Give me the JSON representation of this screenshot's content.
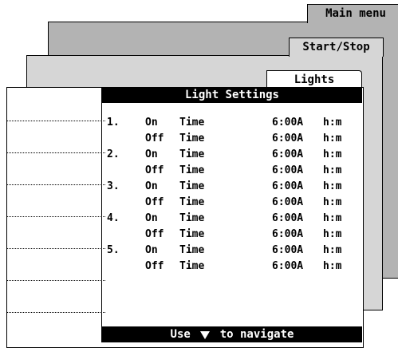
{
  "tabs": {
    "main_menu": "Main menu",
    "start_stop": "Start/Stop",
    "lights": "Lights"
  },
  "panel": {
    "title": "Light Settings",
    "footer_prefix": "Use",
    "footer_suffix": "to navigate",
    "footer_icon": "down-triangle-icon"
  },
  "sidebar": {
    "slots": 7
  },
  "rows": [
    {
      "num": "1.",
      "state": "On",
      "time_label": "Time",
      "value": "6:00A",
      "unit": "h:m"
    },
    {
      "num": "",
      "state": "Off",
      "time_label": "Time",
      "value": "6:00A",
      "unit": "h:m"
    },
    {
      "num": "2.",
      "state": "On",
      "time_label": "Time",
      "value": "6:00A",
      "unit": "h:m"
    },
    {
      "num": "",
      "state": "Off",
      "time_label": "Time",
      "value": "6:00A",
      "unit": "h:m"
    },
    {
      "num": "3.",
      "state": "On",
      "time_label": "Time",
      "value": "6:00A",
      "unit": "h:m"
    },
    {
      "num": "",
      "state": "Off",
      "time_label": "Time",
      "value": "6:00A",
      "unit": "h:m"
    },
    {
      "num": "4.",
      "state": "On",
      "time_label": "Time",
      "value": "6:00A",
      "unit": "h:m"
    },
    {
      "num": "",
      "state": "Off",
      "time_label": "Time",
      "value": "6:00A",
      "unit": "h:m"
    },
    {
      "num": "5.",
      "state": "On",
      "time_label": "Time",
      "value": "6:00A",
      "unit": "h:m"
    },
    {
      "num": "",
      "state": "Off",
      "time_label": "Time",
      "value": "6:00A",
      "unit": "h:m"
    }
  ],
  "colors": {
    "back_card": "#b3b3b3",
    "mid_card": "#d6d6d6",
    "front_card": "#ffffff",
    "header_bg": "#000000",
    "header_fg": "#ffffff"
  }
}
